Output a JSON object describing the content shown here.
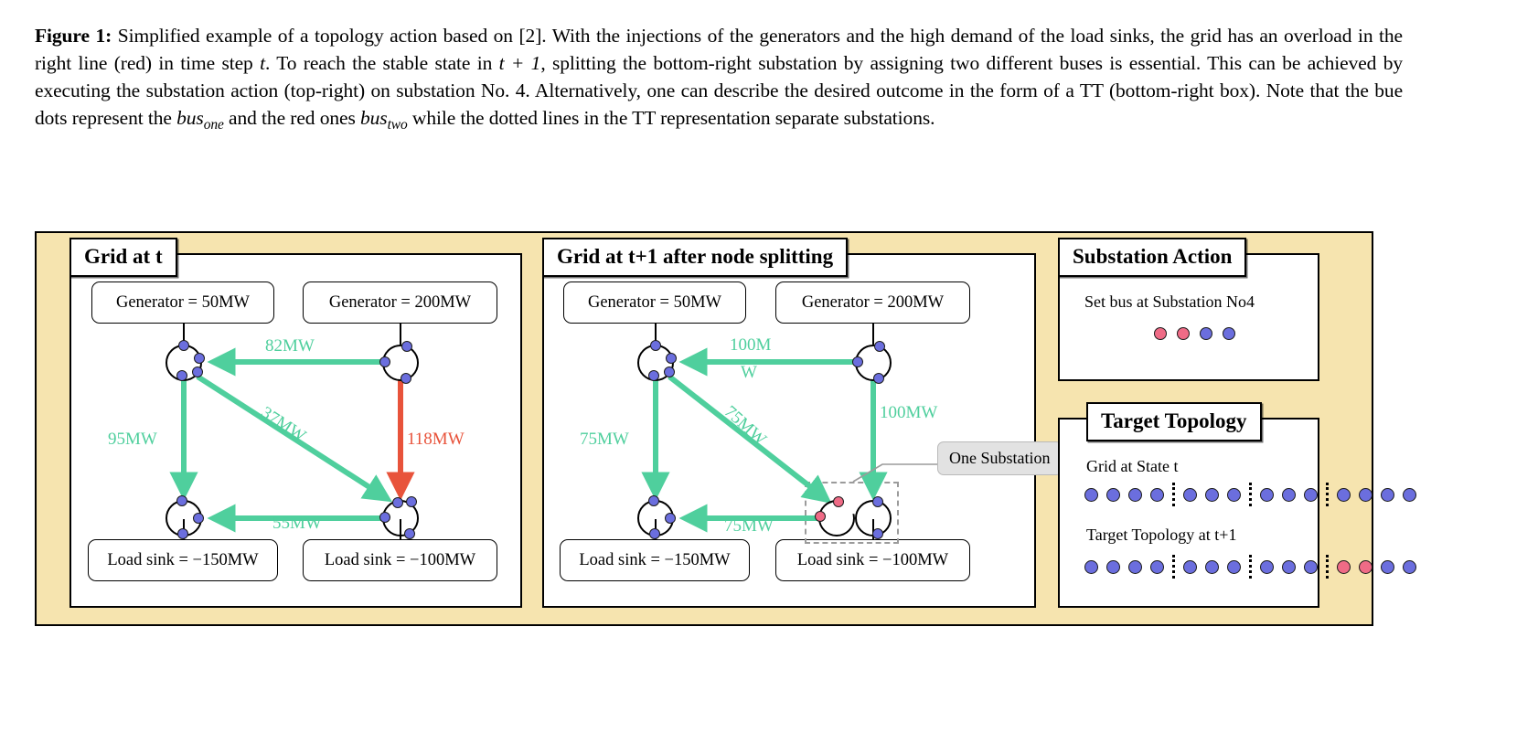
{
  "caption": {
    "label": "Figure 1:",
    "line1": " Simplified example of a topology action based on [2]. With the injections of the generators and the high",
    "line2": "demand of the load sinks, the grid has an overload in the right line (red) in time step ",
    "line2b": ". To reach the stable state in ",
    "line2c": "t + 1",
    "line2d": ",",
    "line3": "splitting the bottom-right substation by assigning two different buses is essential. This can be achieved by executing the",
    "line4": "substation action (top-right) on substation No. 4. Alternatively, one can describe the desired outcome in the form of a",
    "line5a": "TT (bottom-right box). Note that the bue dots represent the ",
    "line5_bus1": "bus",
    "line5_sub1": "one",
    "line5b": " and the red ones ",
    "line5_bus2": "bus",
    "line5_sub2": "two",
    "line5c": " while the dotted lines in the",
    "line6": "TT representation separate substations.",
    "t_italic": "t"
  },
  "colors": {
    "panel_bg": "#f6e4af",
    "flow_green": "#4fcf9d",
    "flow_red": "#e8533b",
    "bus_one_blue": "#6b6ede",
    "bus_two_red": "#ef6b86",
    "callout_bg": "#e2e2e2"
  },
  "grid_t": {
    "title": "Grid at t",
    "generator_left": "Generator = 50MW",
    "generator_right": "Generator = 200MW",
    "load_left": "Load sink = −150MW",
    "load_right": "Load sink = −100MW",
    "flow_top": "82MW",
    "flow_left": "95MW",
    "flow_diag": "37MW",
    "flow_right": "118MW",
    "flow_bottom": "55MW"
  },
  "grid_t1": {
    "title": "Grid at t+1 after node splitting",
    "generator_left": "Generator = 50MW",
    "generator_right": "Generator = 200MW",
    "load_left": "Load sink = −150MW",
    "load_right": "Load sink = −100MW",
    "flow_top_a": "100M",
    "flow_top_b": "W",
    "flow_left": "75MW",
    "flow_diag": "75MW",
    "flow_right": "100MW",
    "flow_bottom": "75MW",
    "callout": "One Substation"
  },
  "substation_action": {
    "title": "Substation Action",
    "text": "Set bus at  Substation No4",
    "dots": [
      "red",
      "red",
      "blue",
      "blue"
    ]
  },
  "target_topology": {
    "title": "Target Topology",
    "row1_label": "Grid at State t",
    "row1_dots": [
      "blue",
      "blue",
      "blue",
      "blue",
      "sep",
      "blue",
      "blue",
      "blue",
      "sep",
      "blue",
      "blue",
      "blue",
      "sep",
      "blue",
      "blue",
      "blue",
      "blue"
    ],
    "row2_label": "Target Topology at t+1",
    "row2_dots": [
      "blue",
      "blue",
      "blue",
      "blue",
      "sep",
      "blue",
      "blue",
      "blue",
      "sep",
      "blue",
      "blue",
      "blue",
      "sep",
      "red",
      "red",
      "blue",
      "blue"
    ]
  }
}
